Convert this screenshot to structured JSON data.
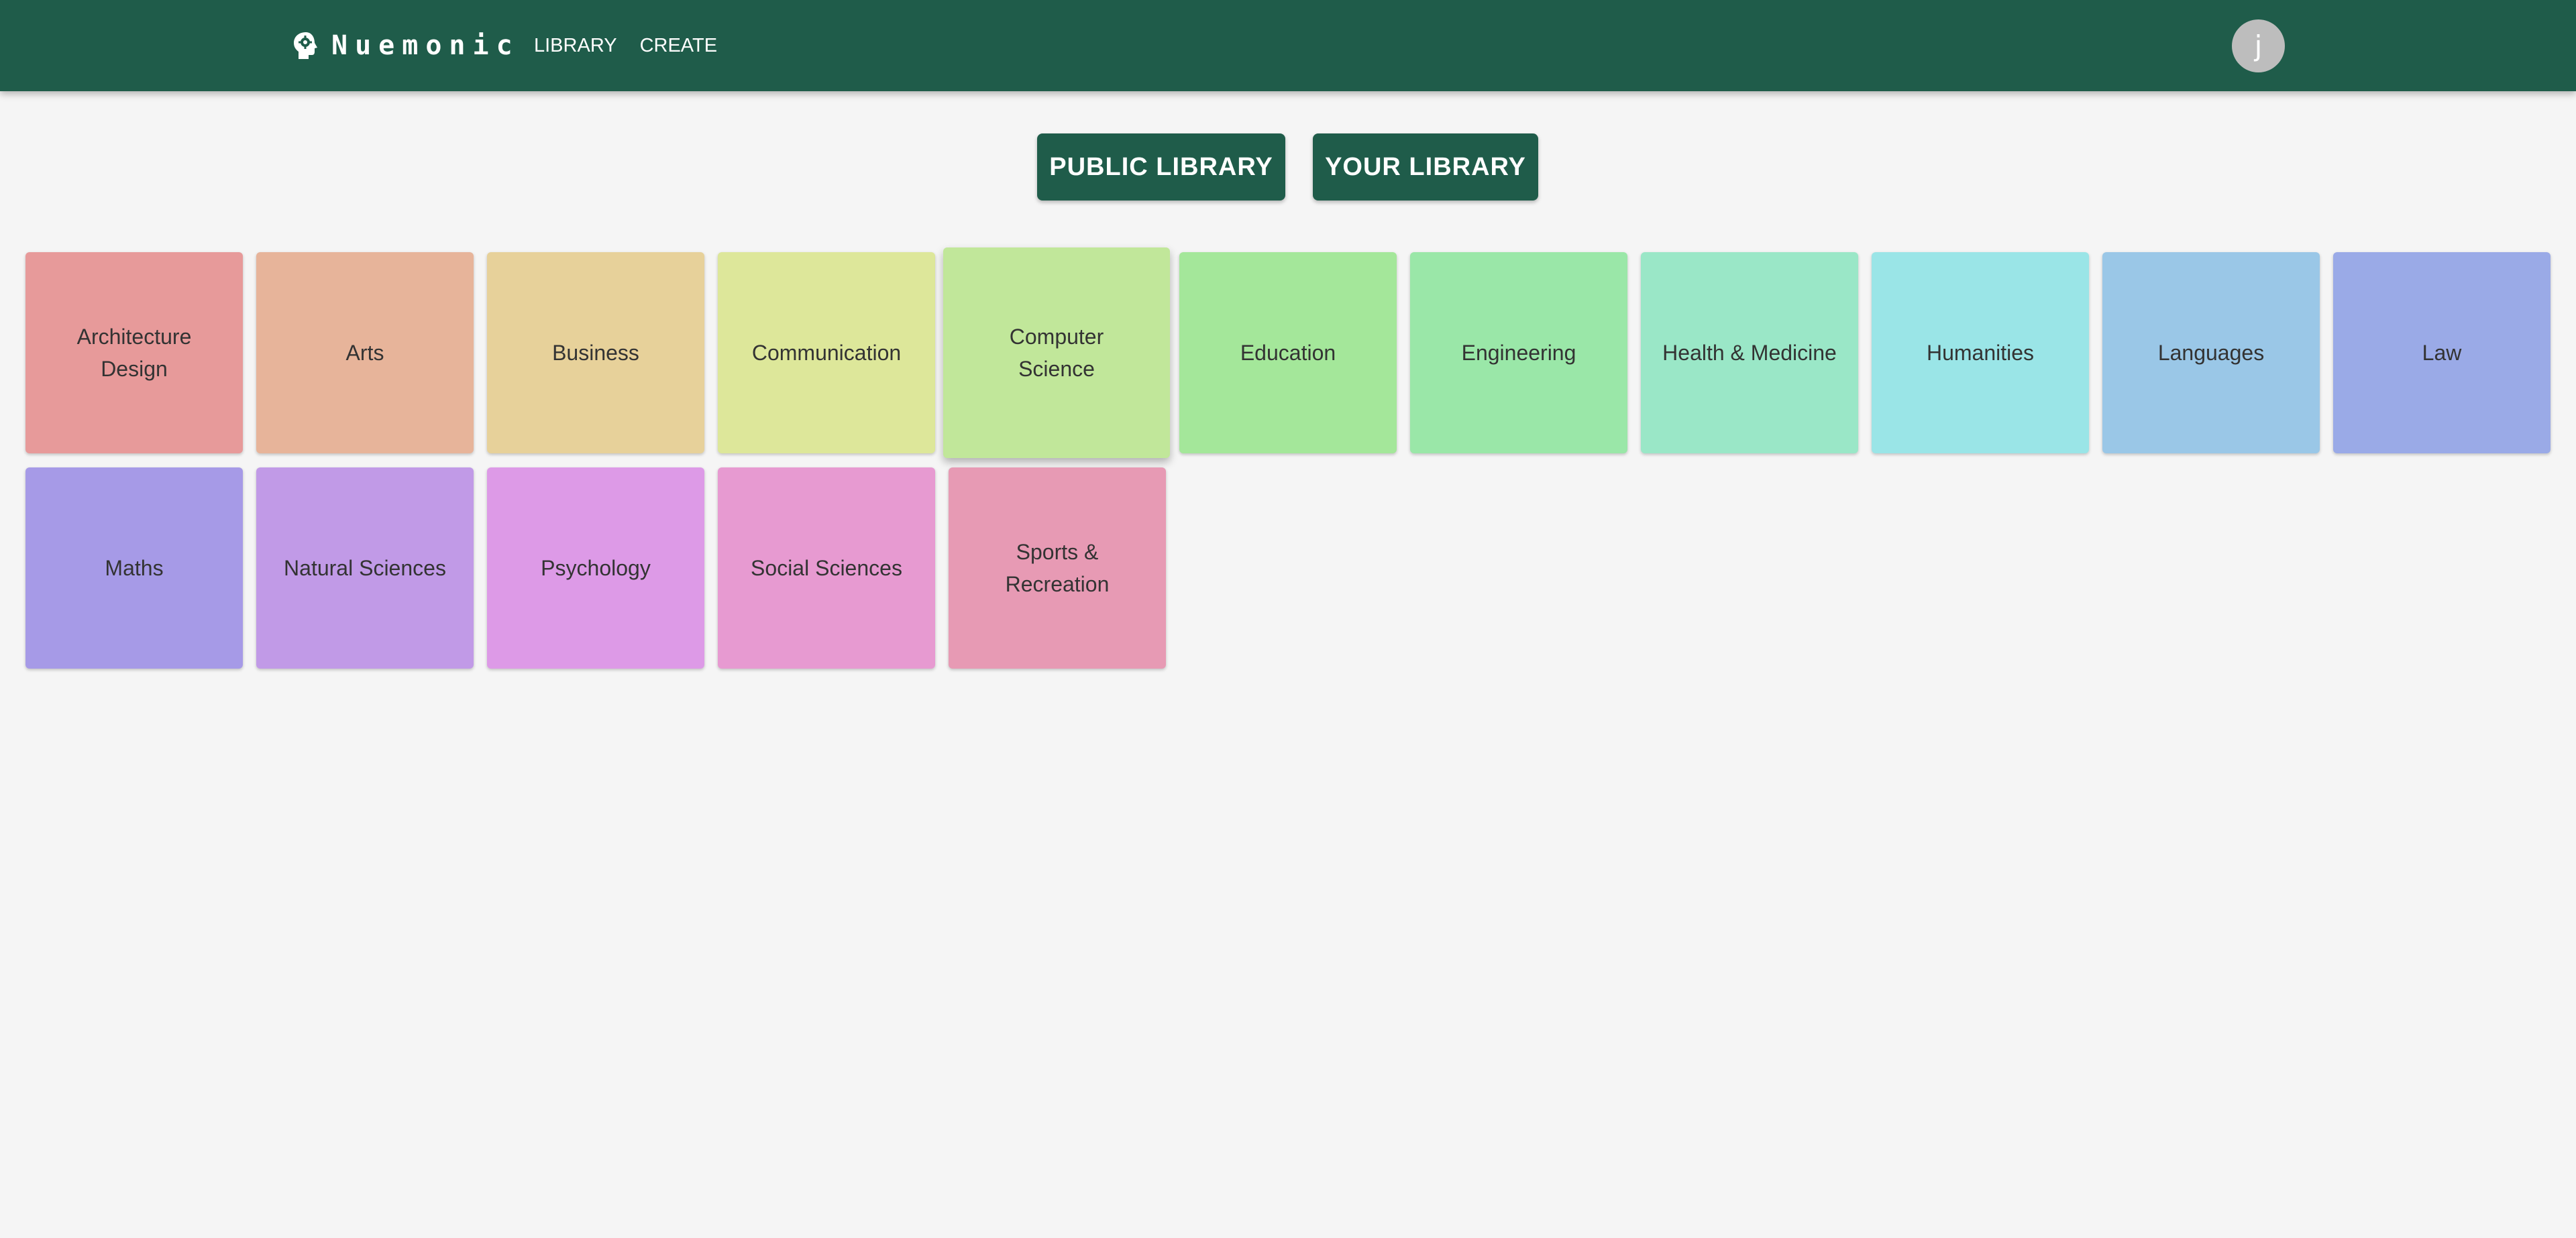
{
  "header": {
    "brand": "Nuemonic",
    "brand_icon": "brain-head-icon",
    "nav": [
      "LIBRARY",
      "CREATE"
    ],
    "avatar_initial": "j",
    "bar_color": "#1f5c4a"
  },
  "library_toggle": {
    "public_label": "PUBLIC LIBRARY",
    "yours_label": "YOUR LIBRARY"
  },
  "categories": [
    {
      "label": "Architecture Design",
      "color": "#e79a9a"
    },
    {
      "label": "Arts",
      "color": "#e7b49a"
    },
    {
      "label": "Business",
      "color": "#e7d19a"
    },
    {
      "label": "Communication",
      "color": "#dde79a"
    },
    {
      "label": "Computer Science",
      "color": "#c1e79a"
    },
    {
      "label": "Education",
      "color": "#a4e79a"
    },
    {
      "label": "Engineering",
      "color": "#9ae7a8"
    },
    {
      "label": "Health & Medicine",
      "color": "#9ae7c7"
    },
    {
      "label": "Humanities",
      "color": "#9ae5e7"
    },
    {
      "label": "Languages",
      "color": "#9ac7e7"
    },
    {
      "label": "Law",
      "color": "#9aaae7"
    },
    {
      "label": "Maths",
      "color": "#a69ae7"
    },
    {
      "label": "Natural Sciences",
      "color": "#c19ae7"
    },
    {
      "label": "Psychology",
      "color": "#dd9ae7"
    },
    {
      "label": "Social Sciences",
      "color": "#e79ad1"
    },
    {
      "label": "Sports & Recreation",
      "color": "#e79ab4"
    }
  ]
}
